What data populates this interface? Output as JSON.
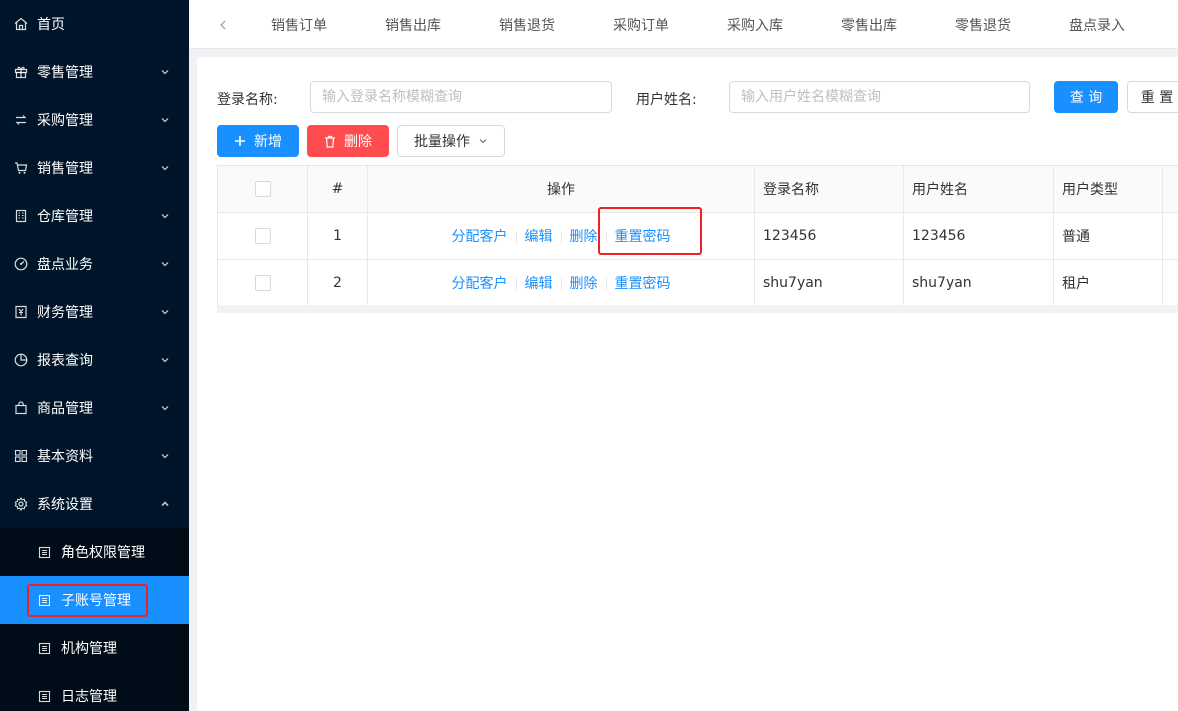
{
  "sidebar": {
    "items": [
      {
        "label": "首页",
        "icon": "home-icon"
      },
      {
        "label": "零售管理",
        "icon": "gift-icon"
      },
      {
        "label": "采购管理",
        "icon": "swap-icon"
      },
      {
        "label": "销售管理",
        "icon": "cart-icon"
      },
      {
        "label": "仓库管理",
        "icon": "building-icon"
      },
      {
        "label": "盘点业务",
        "icon": "dashboard-icon"
      },
      {
        "label": "财务管理",
        "icon": "money-icon"
      },
      {
        "label": "报表查询",
        "icon": "pie-chart-icon"
      },
      {
        "label": "商品管理",
        "icon": "shopping-icon"
      },
      {
        "label": "基本资料",
        "icon": "appstore-icon"
      },
      {
        "label": "系统设置",
        "icon": "setting-icon"
      }
    ],
    "subitems": [
      {
        "label": "角色权限管理",
        "icon": "profile-icon"
      },
      {
        "label": "子账号管理",
        "icon": "profile-icon"
      },
      {
        "label": "机构管理",
        "icon": "profile-icon"
      },
      {
        "label": "日志管理",
        "icon": "profile-icon"
      }
    ]
  },
  "tabs": [
    "销售订单",
    "销售出库",
    "销售退货",
    "采购订单",
    "采购入库",
    "零售出库",
    "零售退货",
    "盘点录入"
  ],
  "filters": {
    "login_label": "登录名称:",
    "login_placeholder": "输入登录名称模糊查询",
    "username_label": "用户姓名:",
    "username_placeholder": "输入用户姓名模糊查询",
    "query_button": "查 询",
    "reset_button": "重 置"
  },
  "toolbar": {
    "add_button": "新增",
    "delete_button": "删除",
    "batch_button": "批量操作"
  },
  "table": {
    "headers": [
      "#",
      "操作",
      "登录名称",
      "用户姓名",
      "用户类型"
    ],
    "actions": [
      "分配客户",
      "编辑",
      "删除",
      "重置密码"
    ],
    "rows": [
      {
        "index": "1",
        "login": "123456",
        "name": "123456",
        "type": "普通"
      },
      {
        "index": "2",
        "login": "shu7yan",
        "name": "shu7yan",
        "type": "租户"
      }
    ]
  },
  "colors": {
    "sidebar_bg": "#001529",
    "submenu_bg": "#000c17",
    "primary": "#1890ff",
    "danger": "#ff4d4f",
    "highlight_box": "#ee2222"
  }
}
